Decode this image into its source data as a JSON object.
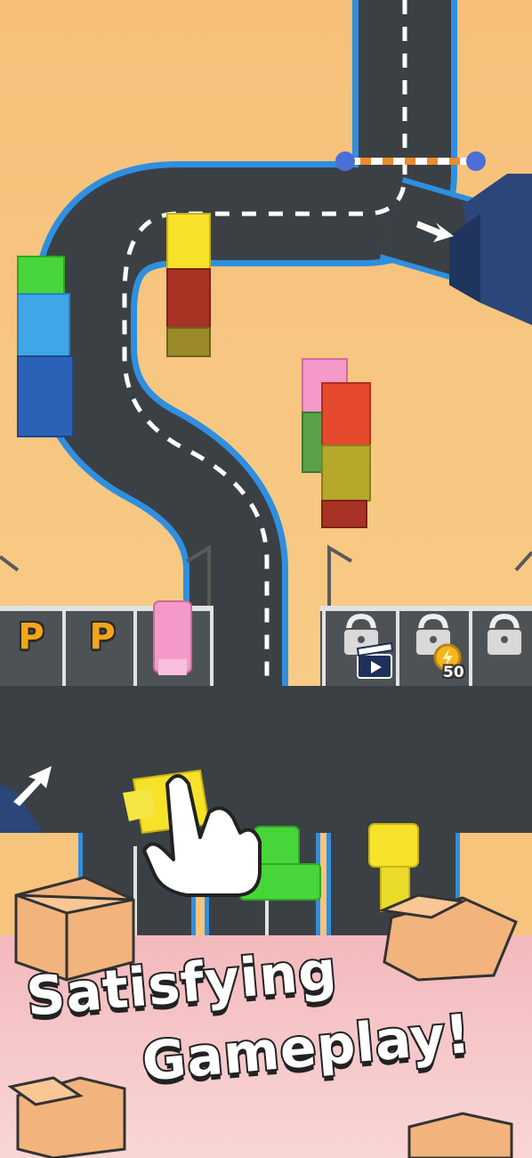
{
  "promo": {
    "line1": "Satisfying",
    "line2": "Gameplay!"
  },
  "parking": {
    "p_label": "P",
    "coin_cost": "50"
  },
  "icons": [
    "pointing-hand-icon",
    "lock-icon",
    "clapperboard-icon",
    "coin-icon",
    "arrow-icon",
    "box-icon"
  ],
  "colors": {
    "sand": "#f6c47c",
    "road": "#3b4045",
    "road_edge": "#2f8fe0",
    "pink_band": "#f6c4c8",
    "parking_lot": "#4d5257",
    "accent_yellow": "#f7e22a",
    "accent_green": "#47d63a"
  }
}
